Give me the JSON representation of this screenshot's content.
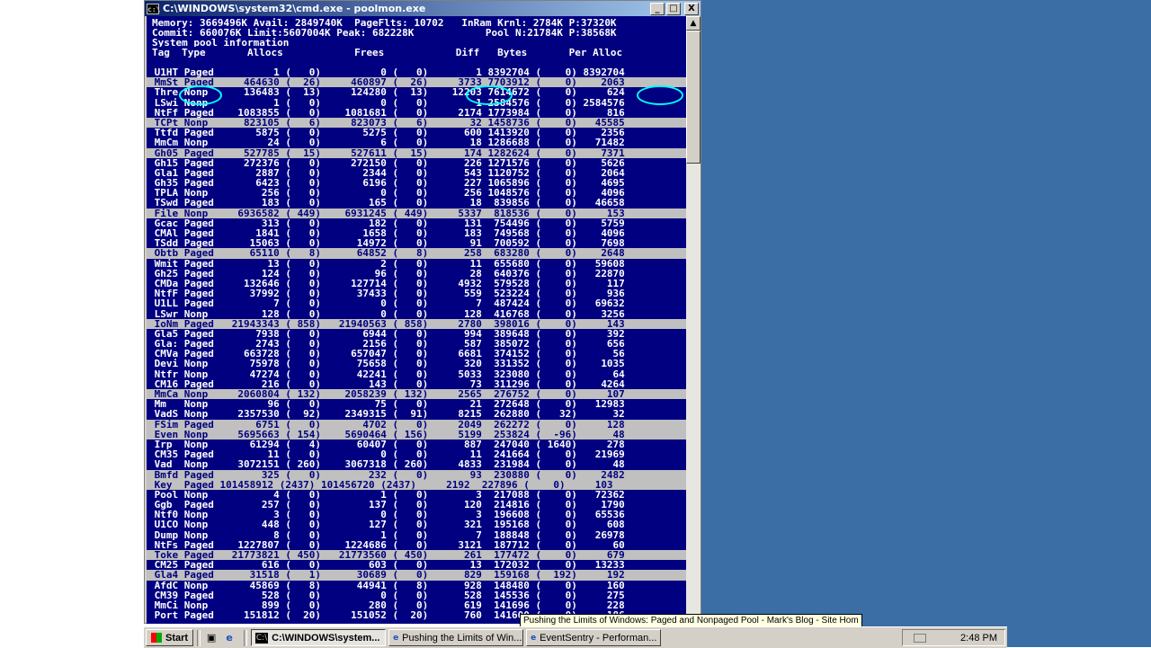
{
  "window": {
    "title": "C:\\WINDOWS\\system32\\cmd.exe - poolmon.exe",
    "icon_label": "c:\\",
    "buttons": {
      "minimize": "_",
      "maximize": "□",
      "close": "X"
    }
  },
  "console": {
    "header_lines": [
      "Memory: 3669496K Avail: 2849740K  PageFlts: 10702   InRam Krnl: 2784K P:37320K",
      "Commit: 660076K Limit:5607004K Peak: 682228K            Pool N:21784K P:38568K",
      "System pool information"
    ],
    "column_header": "Tag  Type       Allocs            Frees            Diff   Bytes       Per Alloc",
    "rows": [
      " U1HT Paged          1 (   0)          0 (   0)        1 8392704 (    0) 8392704",
      " MmSt Paged     464630 (  26)     460897 (  26)     3733 7703912 (    0)    2063",
      " Thre Nonp      136483 (  13)     124280 (  13)    12203 7614672 (    0)     624",
      " LSwi Nonp           1 (   0)          0 (   0)        1 2584576 (    0) 2584576",
      " NtFf Paged    1083855 (   0)    1081681 (   0)     2174 1773984 (    0)     816",
      " TCPt Nonp      823105 (   6)     823073 (   6)       32 1458736 (    0)   45585",
      " Ttfd Paged       5875 (   0)       5275 (   0)      600 1413920 (    0)    2356",
      " MmCm Nonp          24 (   0)          6 (   0)       18 1286688 (    0)   71482",
      " Gh05 Paged     527785 (  15)     527611 (  15)      174 1282624 (    0)    7371",
      " Gh15 Paged     272376 (   0)     272150 (   0)      226 1271576 (    0)    5626",
      " Gla1 Paged       2887 (   0)       2344 (   0)      543 1120752 (    0)    2064",
      " Gh35 Paged       6423 (   0)       6196 (   0)      227 1065896 (    0)    4695",
      " TPLA Nonp         256 (   0)          0 (   0)      256 1048576 (    0)    4096",
      " TSwd Paged        183 (   0)        165 (   0)       18  839856 (    0)   46658",
      " File Nonp     6936582 ( 449)    6931245 ( 449)     5337  818536 (    0)     153",
      " Gcac Paged        313 (   0)        182 (   0)      131  754496 (    0)    5759",
      " CMAl Paged       1841 (   0)       1658 (   0)      183  749568 (    0)    4096",
      " TSdd Paged      15063 (   0)      14972 (   0)       91  700592 (    0)    7698",
      " Obtb Paged      65110 (   8)      64852 (   8)      258  683280 (    0)    2648",
      " Wmit Paged         13 (   0)          2 (   0)       11  655680 (    0)   59608",
      " Gh25 Paged        124 (   0)         96 (   0)       28  640376 (    0)   22870",
      " CMDa Paged     132646 (   0)     127714 (   0)     4932  579528 (    0)     117",
      " NtfF Paged      37992 (   0)      37433 (   0)      559  523224 (    0)     936",
      " U1LL Paged          7 (   0)          0 (   0)        7  487424 (    0)   69632",
      " LSwr Nonp         128 (   0)          0 (   0)      128  416768 (    0)    3256",
      " IoNm Paged   21943343 ( 858)   21940563 ( 858)     2780  398016 (    0)     143",
      " Gla5 Paged       7938 (   0)       6944 (   0)      994  389648 (    0)     392",
      " Gla: Paged       2743 (   0)       2156 (   0)      587  385072 (    0)     656",
      " CMVa Paged     663728 (   0)     657047 (   0)     6681  374152 (    0)      56",
      " Devi Nonp       75978 (   0)      75658 (   0)      320  331352 (    0)    1035",
      " Ntfr Nonp       47274 (   0)      42241 (   0)     5033  323080 (    0)      64",
      " CM16 Paged        216 (   0)        143 (   0)       73  311296 (    0)    4264",
      " MmCa Nonp     2060804 ( 132)    2058239 ( 132)     2565  276752 (    0)     107",
      " Mm   Nonp          96 (   0)         75 (   0)       21  272648 (    0)   12983",
      " VadS Nonp     2357530 (  92)    2349315 (  91)     8215  262880 (   32)      32",
      " FSim Paged       6751 (   0)       4702 (   0)     2049  262272 (    0)     128",
      " Even Nonp     5695663 ( 154)    5690464 ( 156)     5199  253824 (  -96)      48",
      " Irp  Nonp       61294 (   4)      60407 (   0)      887  247040 ( 1640)     278",
      " CM35 Paged         11 (   0)          0 (   0)       11  241664 (    0)   21969",
      " Vad  Nonp     3072151 ( 260)    3067318 ( 260)     4833  231984 (    0)      48",
      " Bmfd Paged        325 (   0)        232 (   0)       93  230880 (    0)    2482",
      " Key  Paged 101458912 (2437) 101456720 (2437)     2192  227896 (    0)     103",
      " Pool Nonp           4 (   0)          1 (   0)        3  217088 (    0)   72362",
      " Ggb  Paged        257 (   0)        137 (   0)      120  214816 (    0)    1790",
      " Ntf0 Nonp           3 (   0)          0 (   0)        3  196608 (    0)   65536",
      " U1CO Nonp         448 (   0)        127 (   0)      321  195168 (    0)     608",
      " Dump Nonp           8 (   0)          1 (   0)        7  188848 (    0)   26978",
      " NtFs Paged    1227807 (   0)    1224686 (   0)     3121  187712 (    0)      60",
      " Toke Paged   21773821 ( 450)   21773560 ( 450)      261  177472 (    0)     679",
      " CM25 Paged        616 (   0)        603 (   0)       13  172032 (    0)   13233",
      " Gla4 Paged      31518 (   1)      30689 (   0)      829  159168 (  192)     192",
      " AfdC Nonp       45869 (   8)      44941 (   8)      928  148480 (    0)     160",
      " CM39 Paged        528 (   0)          0 (   0)      528  145536 (    0)     275",
      " MmCi Nonp         899 (   0)        280 (   0)      619  141696 (    0)     228",
      " Port Paged     151812 (  20)     151052 (  20)      760  141600 (    0)     186"
    ],
    "highlighted_rows": [
      1,
      5,
      8,
      14,
      18,
      25,
      32,
      35,
      36,
      40,
      41,
      48,
      50
    ]
  },
  "tooltip": "Pushing the Limits of Windows: Paged and Nonpaged Pool - Mark's Blog - Site Hom",
  "taskbar": {
    "start_label": "Start",
    "tasks": [
      {
        "icon": "cmd-icon",
        "icon_glyph": "C:\\",
        "label": "C:\\WINDOWS\\system...",
        "active": true
      },
      {
        "icon": "ie-icon",
        "icon_glyph": "e",
        "label": "Pushing the Limits of Win...",
        "active": false
      },
      {
        "icon": "ie-icon",
        "icon_glyph": "e",
        "label": "EventSentry - Performan...",
        "active": false
      }
    ],
    "clock": "2:48 PM"
  },
  "colors": {
    "console_bg": "#000080",
    "console_fg": "#ffffff",
    "highlight_bg": "#c0c0c0",
    "annotation_circle": "#00ffff",
    "desktop": "#3a6ea5"
  }
}
